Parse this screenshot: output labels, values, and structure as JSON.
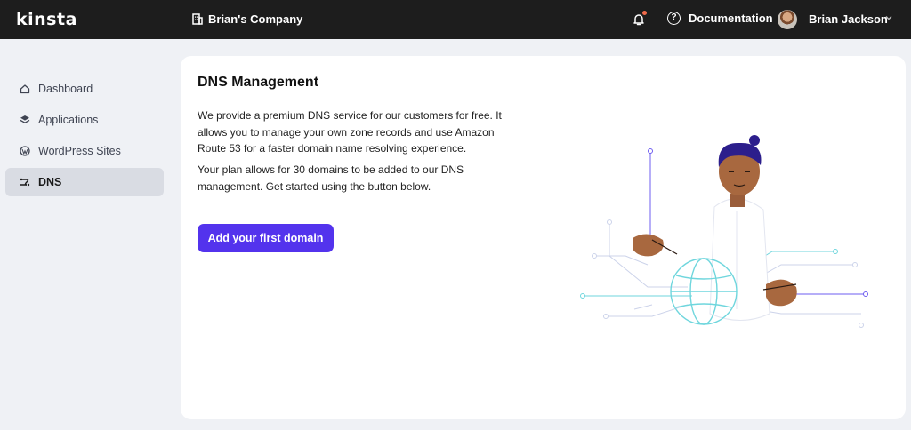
{
  "header": {
    "logo": "KINSTA",
    "company_name": "Brian's Company",
    "documentation_label": "Documentation",
    "user_name": "Brian Jackson"
  },
  "sidebar": {
    "items": [
      {
        "label": "Dashboard",
        "icon": "home-icon"
      },
      {
        "label": "Applications",
        "icon": "layers-icon"
      },
      {
        "label": "WordPress Sites",
        "icon": "wordpress-icon"
      },
      {
        "label": "DNS",
        "icon": "dns-icon",
        "active": true
      }
    ]
  },
  "main": {
    "title": "DNS Management",
    "paragraph1": "We provide a premium DNS service for our customers for free. It allows you to manage your own zone records and use Amazon Route 53 for a faster domain name resolving experience.",
    "paragraph2": "Your plan allows for 30 domains to be added to our DNS management. Get started using the button below.",
    "cta_label": "Add your first domain"
  },
  "colors": {
    "topbar": "#1d1d1d",
    "accent": "#5333ed",
    "notification_dot": "#ef6a4a",
    "sidebar_active": "#d9dce3",
    "globe": "#6fd6dd"
  }
}
